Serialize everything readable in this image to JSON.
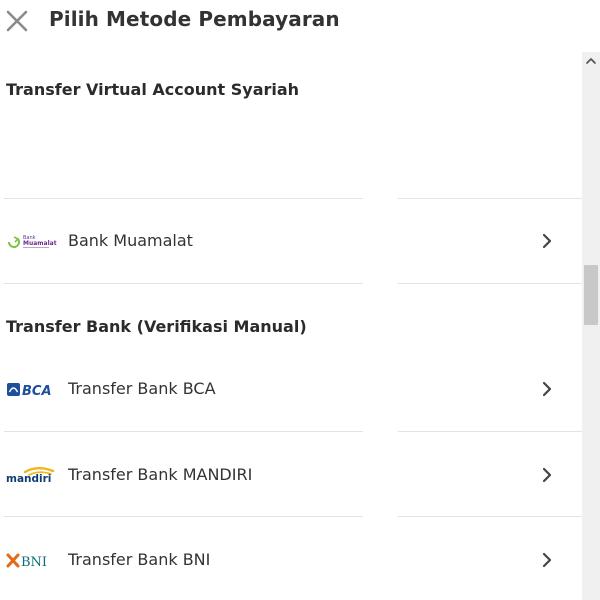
{
  "header": {
    "title": "Pilih Metode Pembayaran",
    "close_icon": "close-icon"
  },
  "sections": [
    {
      "title": "Transfer Virtual Account Syariah",
      "items": [
        {
          "label": "Bank Muamalat",
          "logo_icon": "bank-muamalat-logo",
          "logo_text_1": "Bank",
          "logo_text_2": "Muamalat"
        }
      ]
    },
    {
      "title": "Transfer Bank (Verifikasi Manual)",
      "items": [
        {
          "label": "Transfer Bank BCA",
          "logo_icon": "bca-logo",
          "logo_text": "BCA"
        },
        {
          "label": "Transfer Bank MANDIRI",
          "logo_icon": "mandiri-logo",
          "logo_text": "mandiri"
        },
        {
          "label": "Transfer Bank BNI",
          "logo_icon": "bni-logo",
          "logo_text": "BNI"
        }
      ]
    }
  ],
  "colors": {
    "text": "#333333",
    "divider": "#e3e3e3",
    "muamalat_purple": "#6b2d8a",
    "muamalat_green": "#7cc243",
    "bca_blue": "#1d4f9c",
    "mandiri_navy": "#0f3c73",
    "mandiri_gold": "#f4b41a",
    "bni_orange": "#e26a1b",
    "bni_teal": "#0a6e7a"
  }
}
